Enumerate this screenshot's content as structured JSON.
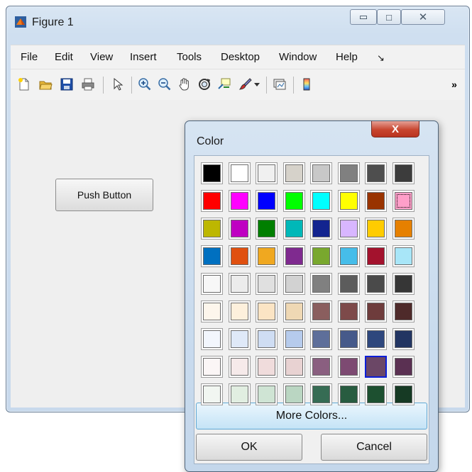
{
  "window": {
    "title": "Figure 1",
    "minimize": "▭",
    "maximize": "□",
    "close": "✕"
  },
  "menu": [
    "File",
    "Edit",
    "View",
    "Insert",
    "Tools",
    "Desktop",
    "Window",
    "Help",
    "↘"
  ],
  "toolbar": {
    "overflow": "»",
    "icons": [
      "new-figure-icon",
      "open-folder-icon",
      "save-icon",
      "print-icon",
      "pointer-icon",
      "zoom-in-icon",
      "zoom-out-icon",
      "pan-hand-icon",
      "rotate-3d-icon",
      "data-cursor-icon",
      "brush-icon",
      "dropdown-arrow-icon",
      "link-plot-icon",
      "colorbar-icon"
    ]
  },
  "figure": {
    "push_button": "Push Button"
  },
  "color_dialog": {
    "title": "Color",
    "close": "X",
    "more_colors": "More Colors...",
    "ok": "OK",
    "cancel": "Cancel",
    "selected_color": "#6b4766",
    "swatches": [
      [
        "#000000",
        "#ffffff",
        "#f0f0f0",
        "#d6d2ca",
        "#c8c8c8",
        "#808080",
        "#4e4e4e",
        "#3c3c3c"
      ],
      [
        "#ff0000",
        "#ff00ff",
        "#0000ff",
        "#00ff00",
        "#00ffff",
        "#ffff00",
        "#993300",
        "#ff9fc9"
      ],
      [
        "#bdb700",
        "#bf00c2",
        "#007f00",
        "#00b8b8",
        "#13248f",
        "#d8b6ff",
        "#ffcc00",
        "#e68000"
      ],
      [
        "#0070c0",
        "#e05010",
        "#f0a820",
        "#7f2a8f",
        "#79a82e",
        "#46bde9",
        "#a3122d",
        "#a8e6f8"
      ],
      [
        "#f7f7f7",
        "#ececec",
        "#e0e0e0",
        "#d2d2d2",
        "#808080",
        "#5c5c5c",
        "#4a4a4a",
        "#363636"
      ],
      [
        "#fdf6ec",
        "#fdf0dc",
        "#fbe4c4",
        "#efd8b4",
        "#8a5e5e",
        "#7d4a4a",
        "#6e3c3c",
        "#4e2a2a"
      ],
      [
        "#f2f6fd",
        "#dfe9f8",
        "#cfddf3",
        "#b6cbec",
        "#5e6f9a",
        "#465a8a",
        "#2e477d",
        "#223562"
      ],
      [
        "#fbf6f6",
        "#f6eaea",
        "#f0dcdc",
        "#e8d2d2",
        "#8a5f80",
        "#7d4a72",
        "#6b4766",
        "#5a3052"
      ],
      [
        "#f1f6f1",
        "#e1eee1",
        "#cfe4d4",
        "#bad6c2",
        "#366c54",
        "#285c40",
        "#1d5030",
        "#163a24"
      ]
    ]
  }
}
